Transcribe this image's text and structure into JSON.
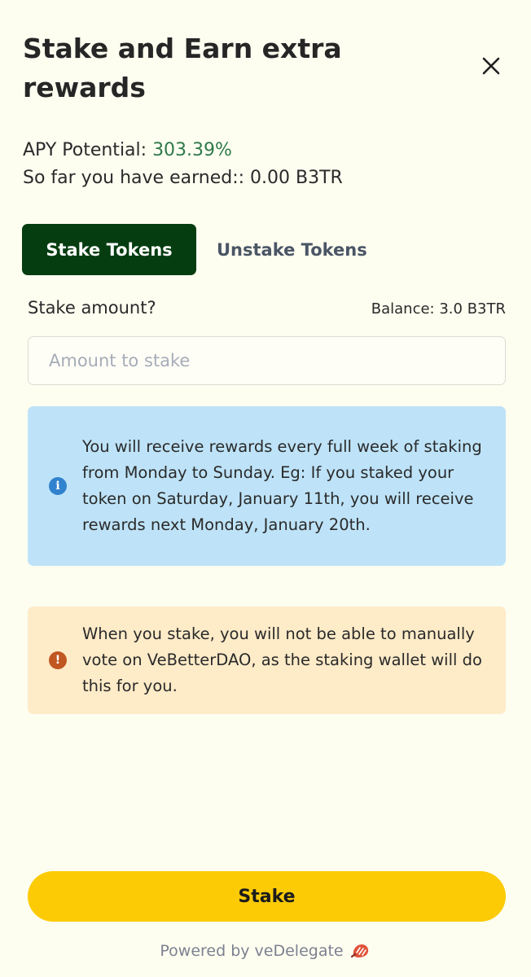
{
  "header": {
    "title": "Stake and Earn extra rewards",
    "close_icon": "close-icon"
  },
  "stats": {
    "apy_label": "APY Potential: ",
    "apy_value": "303.39%",
    "earned_text": "So far you have earned:: 0.00 B3TR"
  },
  "tabs": [
    {
      "label": "Stake Tokens",
      "active": true
    },
    {
      "label": "Unstake Tokens",
      "active": false
    }
  ],
  "form": {
    "amount_label": "Stake amount?",
    "balance_text": "Balance: 3.0 B3TR",
    "amount_value": "",
    "amount_placeholder": "Amount to stake"
  },
  "alerts": {
    "info": {
      "icon": "info-icon",
      "text": "You will receive rewards every full week of staking from Monday to Sunday. Eg: If you staked your token on Saturday, January 11th, you will receive rewards next Monday, January 20th."
    },
    "warning": {
      "icon": "warning-icon",
      "text": "When you stake, you will not be able to manually vote on VeBetterDAO, as the staking wallet will do this for you."
    }
  },
  "actions": {
    "stake_label": "Stake"
  },
  "footer": {
    "powered_by": "Powered by veDelegate",
    "logo_icon": "vedelegate-logo-icon"
  },
  "colors": {
    "background": "#fdfdf0",
    "apy_green": "#2e7a4a",
    "active_tab": "#053d10",
    "info_bg": "#bee3f8",
    "warning_bg": "#feebc8",
    "stake_button": "#fccb05"
  }
}
